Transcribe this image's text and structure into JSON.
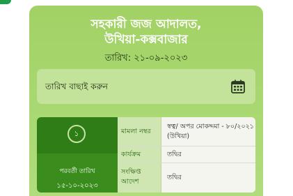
{
  "header": {
    "court_name_line1": "সহকারী জজ আদালত,",
    "court_name_line2": "উখিয়া-কক্সবাজার",
    "date_line": "তারিখ: ২১-০৯-২০২৩"
  },
  "date_picker": {
    "label": "তারিখ বাছাই করুন",
    "icon": "calendar-icon"
  },
  "case": {
    "serial": "১",
    "next_date_label": "পরবর্তী তারিখ",
    "next_date_value": "১৫-১০-২০২৩",
    "rows": [
      {
        "key": "মামলা নম্বর",
        "value": "স্বত্ব/ অপর মোকদ্দমা - ৮০/২০২১ (উখিয়া)"
      },
      {
        "key": "কার্যক্রম",
        "value": "তদ্বির"
      },
      {
        "key": "সংক্ষিপ্ত আদেশ",
        "value": "তদ্বির"
      }
    ]
  },
  "colors": {
    "card": "#a9d872",
    "serial_panel": "#2f7d16",
    "key_cell": "#cfe5b2",
    "accent": "#1e9e4a"
  }
}
